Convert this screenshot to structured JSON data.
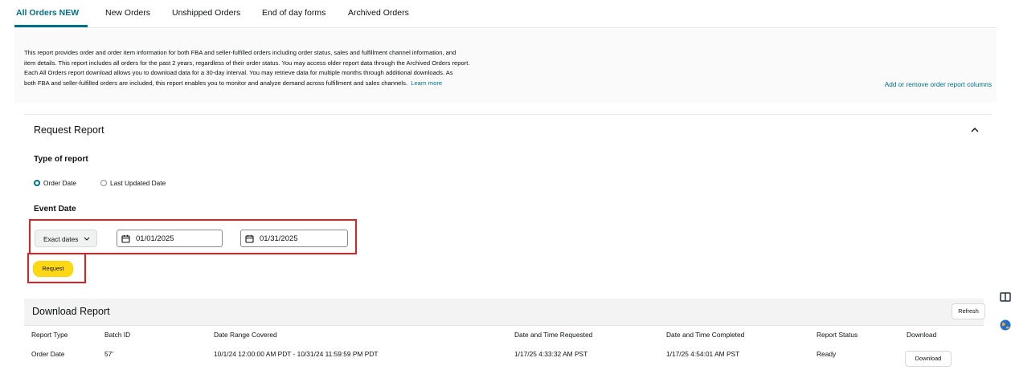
{
  "tabs": [
    {
      "label": "All Orders NEW",
      "active": true
    },
    {
      "label": "New Orders"
    },
    {
      "label": "Unshipped Orders"
    },
    {
      "label": "End of day forms"
    },
    {
      "label": "Archived Orders"
    }
  ],
  "description": {
    "lines": [
      "This report provides order and order item information for both FBA and seller-fulfilled orders including order status, sales and fulfillment channel information, and",
      "item details. This report includes all orders for the past 2 years, regardless of their order status. You may access older report data through the Archived Orders report.",
      "Each All Orders report download allows you to download data for a 30-day interval. You may retrieve data for multiple months through additional downloads. As",
      "both FBA and seller-fulfilled orders are included, this report enables you to monitor and analyze demand across fulfillment and sales channels."
    ],
    "learn_more": "Learn more"
  },
  "add_remove_link": "Add or remove order report columns",
  "request_report": {
    "title": "Request Report",
    "type_label": "Type of report",
    "radio_order_date": "Order Date",
    "radio_last_updated": "Last Updated Date",
    "selected_type": "Order Date",
    "event_date_label": "Event Date",
    "date_mode": "Exact dates",
    "start_date": "01/01/2025",
    "end_date": "01/31/2025",
    "request_button": "Request"
  },
  "download_report": {
    "title": "Download Report",
    "refresh_button": "Refresh",
    "columns": [
      "Report Type",
      "Batch ID",
      "Date Range Covered",
      "Date and Time Requested",
      "Date and Time Completed",
      "Report Status",
      "Download"
    ],
    "rows": [
      {
        "report_type": "Order Date",
        "batch_id": "57'",
        "date_range": "10/1/24 12:00:00 AM PDT - 10/31/24 11:59:59 PM PDT",
        "requested": "1/17/25 4:33:32 AM PST",
        "completed": "1/17/25 4:54:01 AM PST",
        "status": "Ready",
        "download_button": "Download"
      }
    ]
  },
  "colors": {
    "accent": "#007185",
    "highlight_box": "#e01f1f",
    "primary_button": "#ffd814"
  },
  "icons": {
    "collapse": "chevron-up-icon",
    "date_mode": "chevron-down-icon",
    "date_picker": "calendar-icon",
    "edge_1": "panel-toggle-icon",
    "edge_2": "globe-icon"
  }
}
